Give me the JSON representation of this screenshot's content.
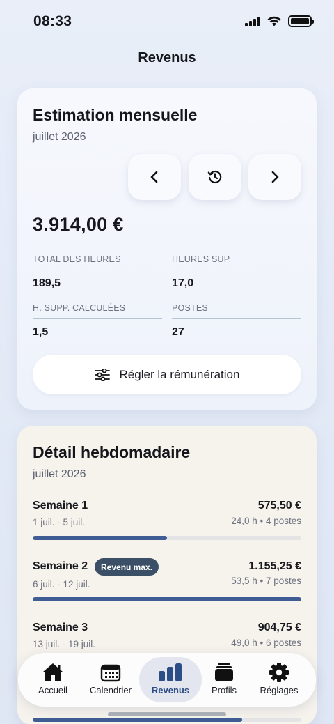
{
  "status_bar": {
    "time": "08:33"
  },
  "header": {
    "title": "Revenus"
  },
  "estimation": {
    "title": "Estimation mensuelle",
    "month": "juillet 2026",
    "amount": "3.914,00 €",
    "stats": [
      {
        "label": "TOTAL DES HEURES",
        "value": "189,5"
      },
      {
        "label": "HEURES SUP.",
        "value": "17,0"
      },
      {
        "label": "H. SUPP. CALCULÉES",
        "value": "1,5"
      },
      {
        "label": "POSTES",
        "value": "27"
      }
    ],
    "adjust_button_label": "Régler la rémunération"
  },
  "weekly": {
    "title": "Détail hebdomadaire",
    "month": "juillet 2026",
    "weeks": [
      {
        "name": "Semaine 1",
        "dates": "1 juil. - 5 juil.",
        "amount": "575,50 €",
        "meta": "24,0 h • 4 postes",
        "progress": 0.5
      },
      {
        "name": "Semaine 2",
        "badge": "Revenu max.",
        "dates": "6 juil. - 12 juil.",
        "amount": "1.155,25 €",
        "meta": "53,5 h • 7 postes",
        "progress": 1.0
      },
      {
        "name": "Semaine 3",
        "dates": "13 juil. - 19 juil.",
        "amount": "904,75 €",
        "meta": "49,0 h • 6 postes",
        "progress": 0.78
      }
    ]
  },
  "tabs": [
    {
      "label": "Accueil",
      "icon": "house-icon"
    },
    {
      "label": "Calendrier",
      "icon": "calendar-icon"
    },
    {
      "label": "Revenus",
      "icon": "bar-chart-icon",
      "active": true
    },
    {
      "label": "Profils",
      "icon": "stack-icon"
    },
    {
      "label": "Réglages",
      "icon": "gear-icon"
    }
  ],
  "colors": {
    "accent": "#2d4d86",
    "progress": "#3f5d94",
    "badge": "#3b5066"
  }
}
